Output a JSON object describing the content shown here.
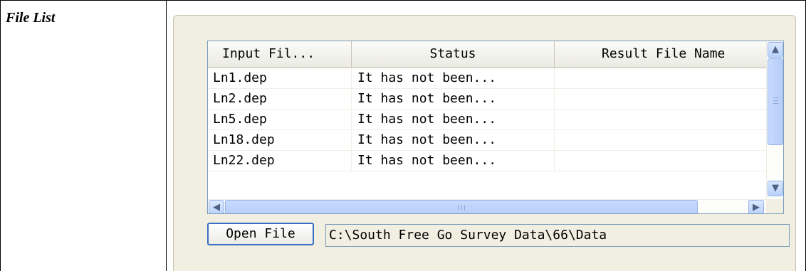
{
  "doc": {
    "label": "File List"
  },
  "list": {
    "columns": [
      "Input Fil...",
      "Status",
      "Result File Name"
    ],
    "rows": [
      [
        "Ln1.dep",
        "It has not been...",
        ""
      ],
      [
        "Ln2.dep",
        "It has not been...",
        ""
      ],
      [
        "Ln5.dep",
        "It has not been...",
        ""
      ],
      [
        "Ln18.dep",
        "It has not been...",
        ""
      ],
      [
        "Ln22.dep",
        "It has not been...",
        ""
      ]
    ]
  },
  "controls": {
    "open_file_label": "Open File",
    "path_value": "C:\\South Free Go Survey Data\\66\\Data"
  },
  "icons": {
    "scroll_up": "chevron-up-icon",
    "scroll_down": "chevron-down-icon",
    "scroll_left": "chevron-left-icon",
    "scroll_right": "chevron-right-icon"
  },
  "colors": {
    "panel_bg": "#f1efe2",
    "scrollbar_blue": "#b8d1fa",
    "button_border": "#3b6fc4"
  }
}
